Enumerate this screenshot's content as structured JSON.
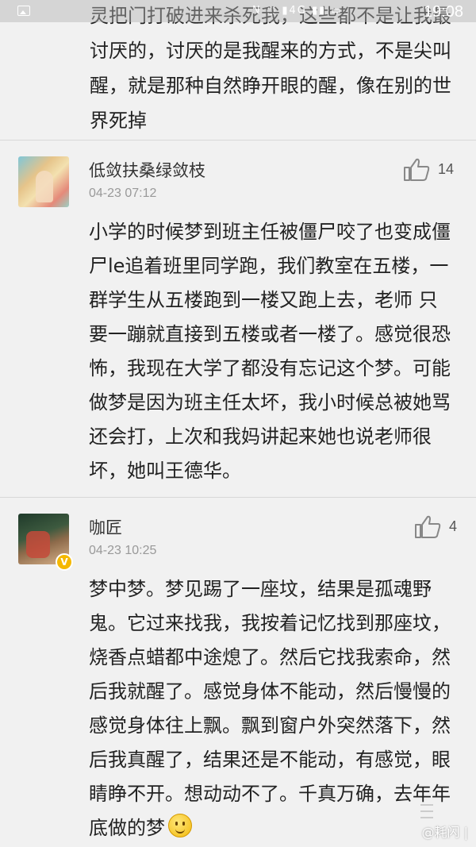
{
  "status_bar": {
    "time": "19:08",
    "network": "4G",
    "icons": [
      "gallery-icon",
      "nfc-icon",
      "signal-icon",
      "battery-icon"
    ]
  },
  "previous_comment": {
    "text": "灵把门打破进来杀死我，这些都不是让我最讨厌的，讨厌的是我醒来的方式，不是尖叫醒，就是那种自然睁开眼的醒，像在别的世界死掉"
  },
  "comments": [
    {
      "username": "低敛扶桑绿敛枝",
      "timestamp": "04-23 07:12",
      "like_count": "14",
      "verified": false,
      "text": "小学的时候梦到班主任被僵尸咬了也变成僵尸le追着班里同学跑，我们教室在五楼，一群学生从五楼跑到一楼又跑上去，老师 只要一蹦就直接到五楼或者一楼了。感觉很恐怖，我现在大学了都没有忘记这个梦。可能做梦是因为班主任太坏，我小时候总被她骂还会打，上次和我妈讲起来她也说老师很坏，她叫王德华。"
    },
    {
      "username": "咖匠",
      "timestamp": "04-23 10:25",
      "like_count": "4",
      "verified": true,
      "verified_badge": "V",
      "text": "梦中梦。梦见踢了一座坟，结果是孤魂野鬼。它过来找我，我按着记忆找到那座坟，烧香点蜡都中途熄了。然后它找我索命，然后我就醒了。感觉身体不能动，然后慢慢的感觉身体往上飘。飘到窗户外突然落下，然后我真醒了，结果还是不能动，有感觉，眼睛睁不开。想动动不了。千真万确，去年年底做的梦"
    }
  ],
  "watermark": "@耗闪 |",
  "colors": {
    "background": "#f1f1f1",
    "text": "#222222",
    "meta": "#999999",
    "divider": "#d8d8d8",
    "verified": "#f5b800"
  }
}
